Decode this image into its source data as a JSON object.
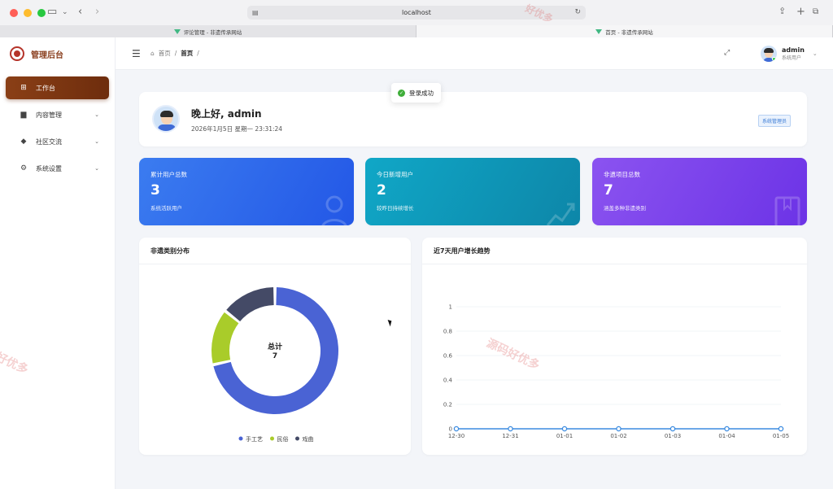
{
  "browser": {
    "url": "localhost",
    "tabs": [
      {
        "label": "评论管理 - 非遗传承网站",
        "active": false
      },
      {
        "label": "首页 - 非遗传承网站",
        "active": true
      }
    ]
  },
  "sidebar": {
    "brand": "管理后台",
    "items": [
      {
        "label": "工作台",
        "icon": "grid-icon",
        "active": true
      },
      {
        "label": "内容管理",
        "icon": "document-icon",
        "expandable": true
      },
      {
        "label": "社区交流",
        "icon": "chat-icon",
        "expandable": true
      },
      {
        "label": "系统设置",
        "icon": "gear-icon",
        "expandable": true
      }
    ]
  },
  "topbar": {
    "breadcrumb_home": "首页",
    "breadcrumb_current": "首页",
    "separator": "/",
    "user_name": "admin",
    "user_role": "系统用户"
  },
  "toast": {
    "message": "登录成功"
  },
  "welcome": {
    "greeting": "晚上好, admin",
    "datetime": "2026年1月5日 星期一 23:31:24",
    "badge": "系统管理员"
  },
  "stats": [
    {
      "label": "累计用户总数",
      "value": "3",
      "sub": "系统活跃用户"
    },
    {
      "label": "今日新增用户",
      "value": "2",
      "sub": "较昨日持续增长"
    },
    {
      "label": "非遗项目总数",
      "value": "7",
      "sub": "涵盖多种非遗类别"
    }
  ],
  "panels": {
    "pie_title": "非遗类别分布",
    "line_title": "近7天用户增长趋势"
  },
  "chart_data": [
    {
      "type": "pie",
      "donut": true,
      "center_label": "总计",
      "center_value": "7",
      "categories": [
        "手工艺",
        "民俗",
        "戏曲"
      ],
      "values": [
        5,
        1,
        1
      ],
      "colors": [
        "#4a63d4",
        "#a9cc2a",
        "#444a66"
      ],
      "legend": "bottom"
    },
    {
      "type": "line",
      "x": [
        "12-30",
        "12-31",
        "01-01",
        "01-02",
        "01-03",
        "01-04",
        "01-05"
      ],
      "series": [
        {
          "values": [
            0,
            0,
            0,
            0,
            0,
            0,
            0
          ]
        }
      ],
      "yticks": [
        "0",
        "0.2",
        "0.4",
        "0.6",
        "0.8",
        "1"
      ],
      "ylim": [
        0,
        1
      ],
      "grid": true,
      "color": "#3b8be0"
    }
  ],
  "watermarks": [
    "源码好优多",
    "好优多"
  ]
}
